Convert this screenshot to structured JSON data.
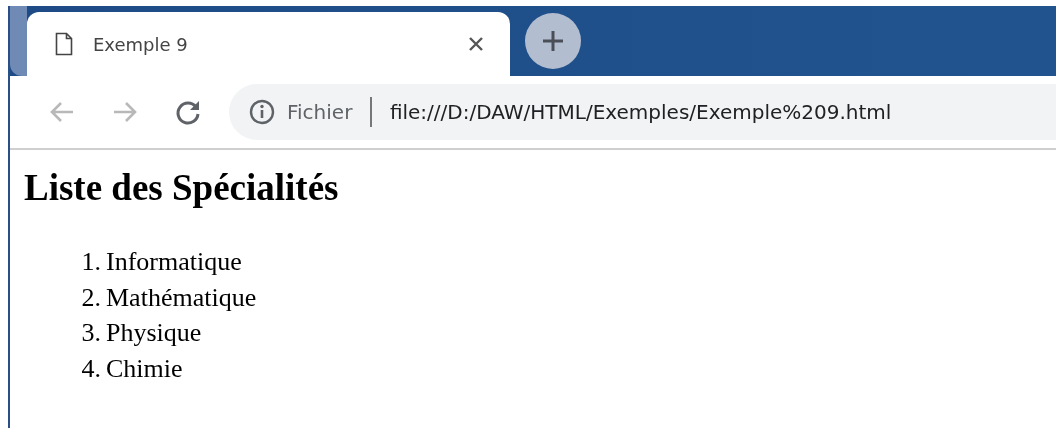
{
  "tabs": [
    {
      "title": "Exemple 9",
      "selected": true
    }
  ],
  "toolbar": {
    "back_disabled": true,
    "forward_disabled": true,
    "security_label": "Fichier",
    "url": "file:///D:/DAW/HTML/Exemples/Exemple%209.html"
  },
  "page": {
    "heading": "Liste des Spécialités",
    "list": [
      {
        "marker": "1.",
        "text": "Informatique"
      },
      {
        "marker": "2.",
        "text": "Mathématique"
      },
      {
        "marker": "3.",
        "text": "Physique"
      },
      {
        "marker": "4.",
        "text": "Chimie"
      }
    ]
  }
}
